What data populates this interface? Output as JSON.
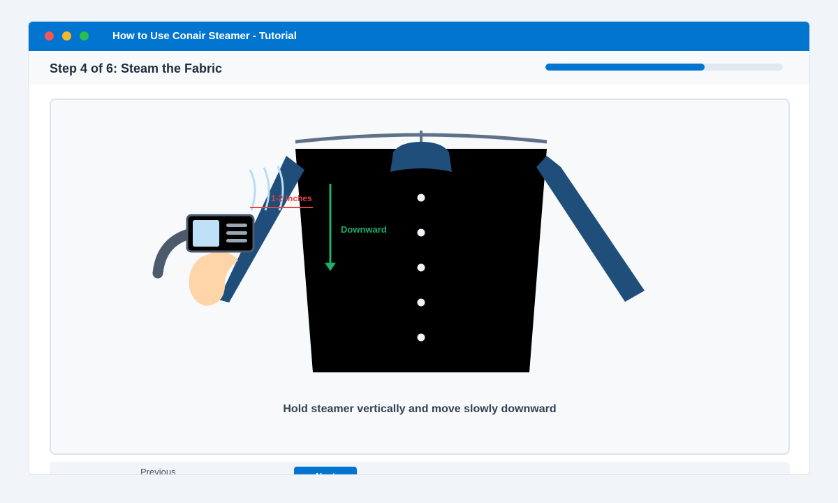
{
  "window": {
    "title": "How to Use Conair Steamer - Tutorial",
    "controls": [
      "close",
      "minimize",
      "maximize"
    ]
  },
  "step": {
    "title": "Step 4 of 6: Steam the Fabric",
    "current": 4,
    "total": 6,
    "progress_fraction": 0.67
  },
  "illustration": {
    "distance_label": "1-2 inches",
    "direction_label": "Downward",
    "caption": "Hold steamer vertically and move slowly downward"
  },
  "navigation": {
    "previous_label": "Previous",
    "next_label": "Next"
  },
  "colors": {
    "accent": "#0275d0",
    "garment": "#000000",
    "sleeve": "#1f4e7a",
    "distance_marker": "#e24545",
    "direction_arrow": "#1bb06b"
  }
}
